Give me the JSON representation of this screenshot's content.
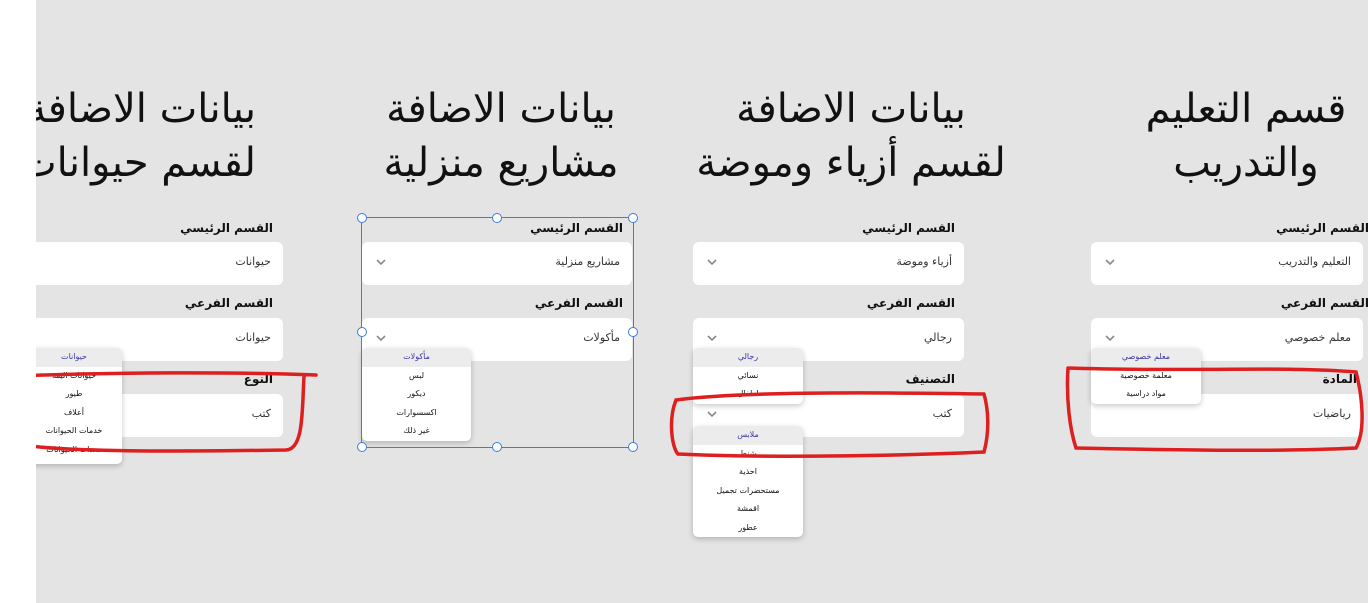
{
  "columns": [
    {
      "id": "education",
      "title": [
        "قسم التعليم",
        "والتدريب"
      ],
      "main_label": "القسم الرئيسي",
      "main_value": "التعليم والتدريب",
      "sub_label": "القسم الفرعي",
      "sub_value": "معلم خصوصي",
      "third_label": "المادة",
      "third_value": "رياضيات",
      "dropdown": {
        "items": [
          "معلم خصوصي",
          "معلمة خصوصية",
          "مواد دراسية"
        ],
        "selected_index": 0
      }
    },
    {
      "id": "fashion",
      "title": [
        "بيانات الاضافة",
        "لقسم أزياء وموضة"
      ],
      "main_label": "القسم الرئيسي",
      "main_value": "أزياء وموضة",
      "sub_label": "القسم الفرعي",
      "sub_value": "رجالي",
      "third_label": "التصنيف",
      "third_value": "كتب",
      "dropdown": {
        "items": [
          "رجالي",
          "نسائي",
          "اطفال"
        ],
        "selected_index": 0
      },
      "dropdown2": {
        "items": [
          "ملابس",
          "شنط",
          "احذية",
          "مستحضرات تجميل",
          "اقمشة",
          "عطور"
        ],
        "selected_index": 0
      }
    },
    {
      "id": "home",
      "title": [
        "بيانات الاضافة",
        "مشاريع منزلية"
      ],
      "main_label": "القسم الرئيسي",
      "main_value": "مشاريع منزلية",
      "sub_label": "القسم الفرعي",
      "sub_value": "مأكولات",
      "dropdown": {
        "items": [
          "مأكولات",
          "لبس",
          "ديكور",
          "اكسسوارات",
          "غير ذلك"
        ],
        "selected_index": 0
      }
    },
    {
      "id": "animals",
      "title": [
        "بيانات الاضافة",
        "لقسم حيوانات"
      ],
      "main_label": "القسم الرئيسي",
      "main_value": "حيوانات",
      "sub_label": "القسم الفرعي",
      "sub_value": "حيوانات",
      "third_label": "النوع",
      "third_value": "كتب",
      "dropdown": {
        "items": [
          "حيوانات",
          "حيوانات اليفة",
          "طيور",
          "أعلاف",
          "خدمات الحيوانات",
          "معدات الحيوانات"
        ],
        "selected_index": 0
      }
    }
  ],
  "colors": {
    "canvas": "#e4e4e4",
    "selected_item_text": "#3b35a8",
    "selection_frame": "#3b7fd9",
    "annotation": "#dd1f1f"
  },
  "icons": {
    "field_arrow": "chevron-down-icon"
  }
}
